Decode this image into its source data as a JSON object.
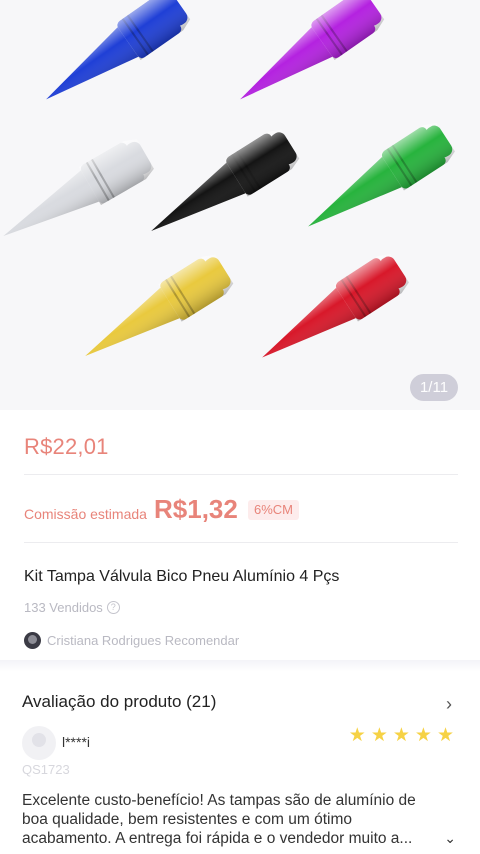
{
  "gallery": {
    "pager": "1/11",
    "products": [
      {
        "name": "spike-blue",
        "color": "#1f3fd6"
      },
      {
        "name": "spike-purple",
        "color": "#b422e0"
      },
      {
        "name": "spike-silver",
        "color": "#d9dbe0"
      },
      {
        "name": "spike-black",
        "color": "#141414"
      },
      {
        "name": "spike-green",
        "color": "#27b33d"
      },
      {
        "name": "spike-gold",
        "color": "#e9c93e"
      },
      {
        "name": "spike-red",
        "color": "#d8182a"
      }
    ]
  },
  "product": {
    "price": "R$22,01",
    "commission_label": "Comissão estimada",
    "commission_value": "R$1,32",
    "commission_badge": "6%CM",
    "title": "Kit Tampa Válvula Bico Pneu Alumínio 4 Pçs",
    "sold": "133 Vendidos",
    "sold_info_icon": "question-circle-icon",
    "recommender": "Cristiana Rodrigues Recomendar"
  },
  "reviews": {
    "heading": "Avaliação do produto (21)",
    "arrow_icon": "chevron-right-icon",
    "user": "l****i",
    "rating": 5,
    "sku": "QS1723",
    "text": "Excelente custo-benefício! As tampas são de alumínio de boa qualidade, bem resistentes e com um ótimo acabamento. A entrega foi rápida e o vendedor muito a...",
    "expand_icon": "chevron-down-icon",
    "star_color": "#f6d245"
  },
  "theme": {
    "accent": "#e8847a"
  }
}
